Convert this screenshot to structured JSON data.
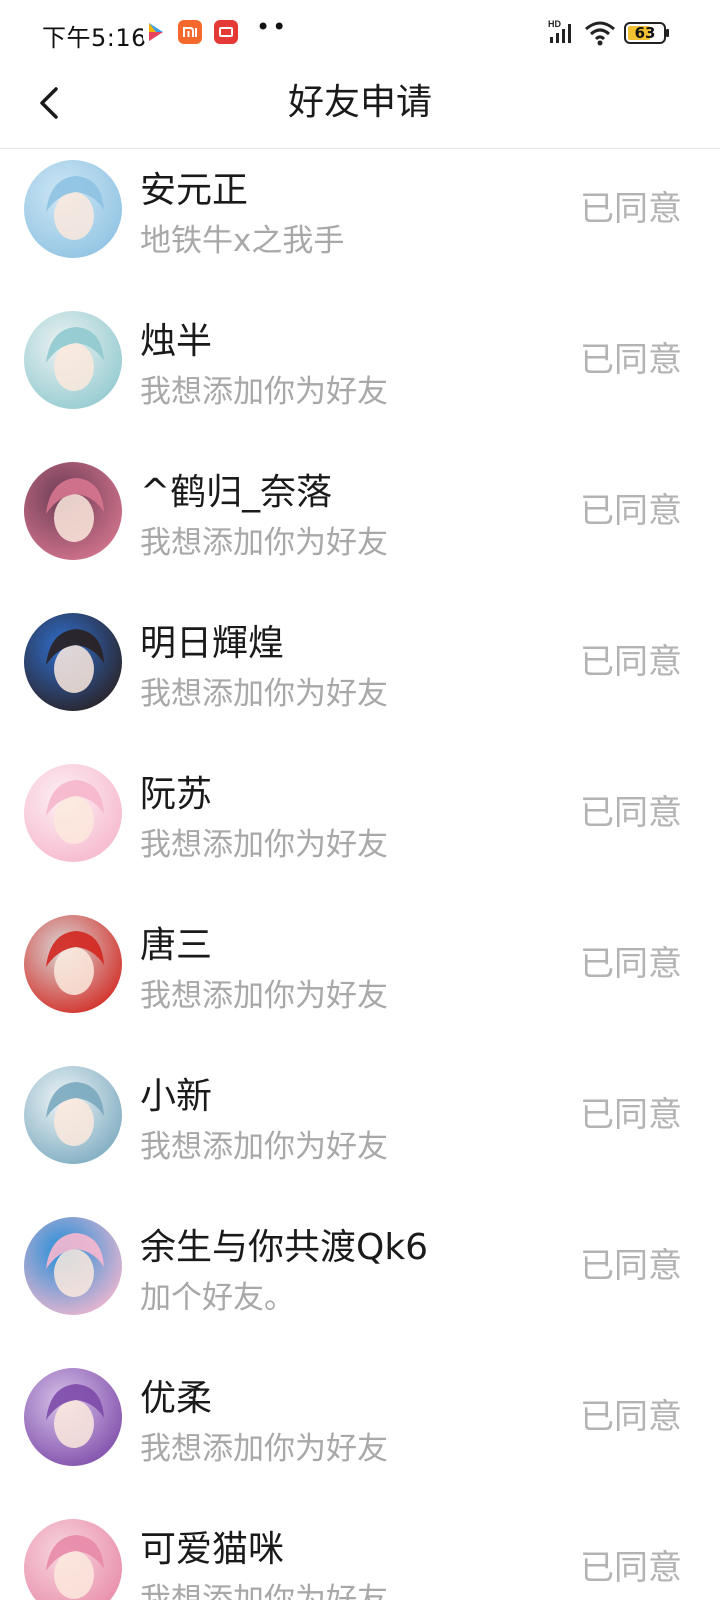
{
  "status_bar": {
    "time": "下午5:16",
    "dots": "••",
    "battery": "63"
  },
  "header": {
    "title": "好友申请"
  },
  "requests": [
    {
      "name": "安元正",
      "message": "地铁牛x之我手",
      "status": "已同意",
      "avatar_colors": [
        "#cfe7f5",
        "#8ec2e2"
      ]
    },
    {
      "name": "烛半",
      "message": "我想添加你为好友",
      "status": "已同意",
      "avatar_colors": [
        "#eef2f2",
        "#8fc9cf"
      ]
    },
    {
      "name": "^鹤归_奈落",
      "message": "我想添加你为好友",
      "status": "已同意",
      "avatar_colors": [
        "#6d3d56",
        "#d7768f"
      ]
    },
    {
      "name": "明日輝煌",
      "message": "我想添加你为好友",
      "status": "已同意",
      "avatar_colors": [
        "#2f6fd0",
        "#2a2020"
      ]
    },
    {
      "name": "阮苏",
      "message": "我想添加你为好友",
      "status": "已同意",
      "avatar_colors": [
        "#fdf1f4",
        "#f6b6cc"
      ]
    },
    {
      "name": "唐三",
      "message": "我想添加你为好友",
      "status": "已同意",
      "avatar_colors": [
        "#d8d8d8",
        "#d3261f"
      ]
    },
    {
      "name": "小新",
      "message": "我想添加你为好友",
      "status": "已同意",
      "avatar_colors": [
        "#eef4f6",
        "#7aa9bf"
      ]
    },
    {
      "name": "余生与你共渡Qk6",
      "message": "加个好友。",
      "status": "已同意",
      "avatar_colors": [
        "#1f8ed8",
        "#f7b8cf"
      ]
    },
    {
      "name": "优柔",
      "message": "我想添加你为好友",
      "status": "已同意",
      "avatar_colors": [
        "#d8c3ea",
        "#7c4aa8"
      ]
    },
    {
      "name": "可爱猫咪",
      "message": "我想添加你为好友",
      "status": "已同意",
      "avatar_colors": [
        "#f7d6df",
        "#e88aa8"
      ]
    }
  ]
}
